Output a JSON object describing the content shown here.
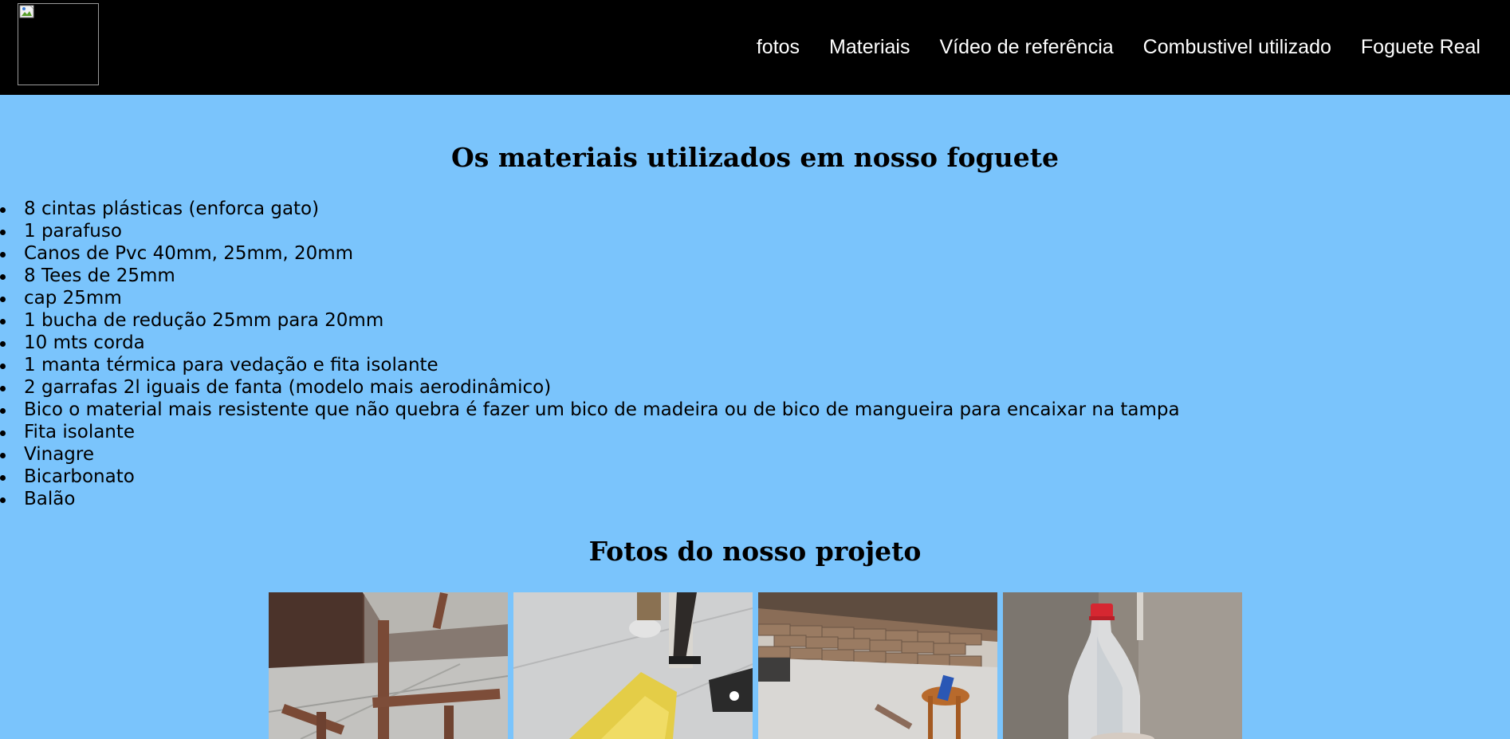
{
  "header": {
    "nav": [
      "fotos",
      "Materiais",
      "Vídeo de referência",
      "Combustivel utilizado",
      "Foguete Real"
    ]
  },
  "materials": {
    "title": "Os materiais utilizados em nosso foguete",
    "items": [
      "8 cintas plásticas (enforca gato)",
      "1 parafuso",
      "Canos de Pvc 40mm, 25mm, 20mm",
      "8 Tees de 25mm",
      "cap 25mm",
      "1 bucha de redução 25mm para 20mm",
      "10 mts corda",
      "1 manta térmica para vedação e fita isolante",
      "2 garrafas 2l iguais de fanta (modelo mais aerodinâmico)",
      "Bico o material mais resistente que não quebra é fazer um bico de madeira ou de bico de mangueira para encaixar na tampa",
      "Fita isolante",
      "Vinagre",
      "Bicarbonato",
      "Balão"
    ]
  },
  "photos": {
    "title": "Fotos do nosso projeto"
  },
  "colors": {
    "page_bg": "#7ac4fc",
    "header_bg": "#000000",
    "nav_text": "#ffffff"
  },
  "icons": [
    "broken-image-icon"
  ]
}
